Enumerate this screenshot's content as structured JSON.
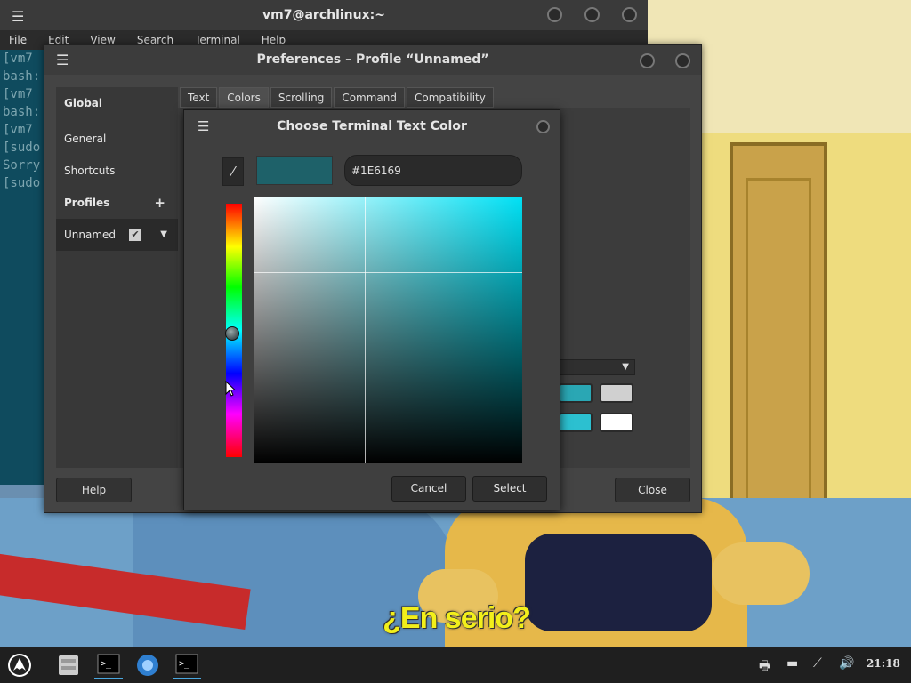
{
  "terminal": {
    "title": "vm7@archlinux:~",
    "menu": [
      "File",
      "Edit",
      "View",
      "Search",
      "Terminal",
      "Help"
    ],
    "lines": [
      "[vm7",
      "bash:",
      "[vm7",
      "bash:",
      "[vm7",
      "[sudo",
      "Sorry",
      "[sudo"
    ]
  },
  "preferences": {
    "title": "Preferences – Profile “Unnamed”",
    "sidebar": {
      "global": "Global",
      "general": "General",
      "shortcuts": "Shortcuts",
      "profiles": "Profiles",
      "profile_name": "Unnamed"
    },
    "tabs": [
      "Text",
      "Colors",
      "Scrolling",
      "Command",
      "Compatibility"
    ],
    "active_tab": "Colors",
    "help_label": "Help",
    "close_label": "Close"
  },
  "color_dialog": {
    "title": "Choose Terminal Text Color",
    "hex_value": "#1E6169",
    "preview_color": "#1E6169",
    "cancel_label": "Cancel",
    "select_label": "Select"
  },
  "taskbar": {
    "clock": "21:18",
    "icons": [
      "arch-logo-icon",
      "file-manager-icon",
      "terminal-icon",
      "web-browser-icon",
      "terminal-2-icon"
    ],
    "tray": [
      "printer-icon",
      "keyboard-icon",
      "network-icon",
      "volume-icon"
    ]
  },
  "wallpaper": {
    "subtitle": "¿En serio?"
  }
}
